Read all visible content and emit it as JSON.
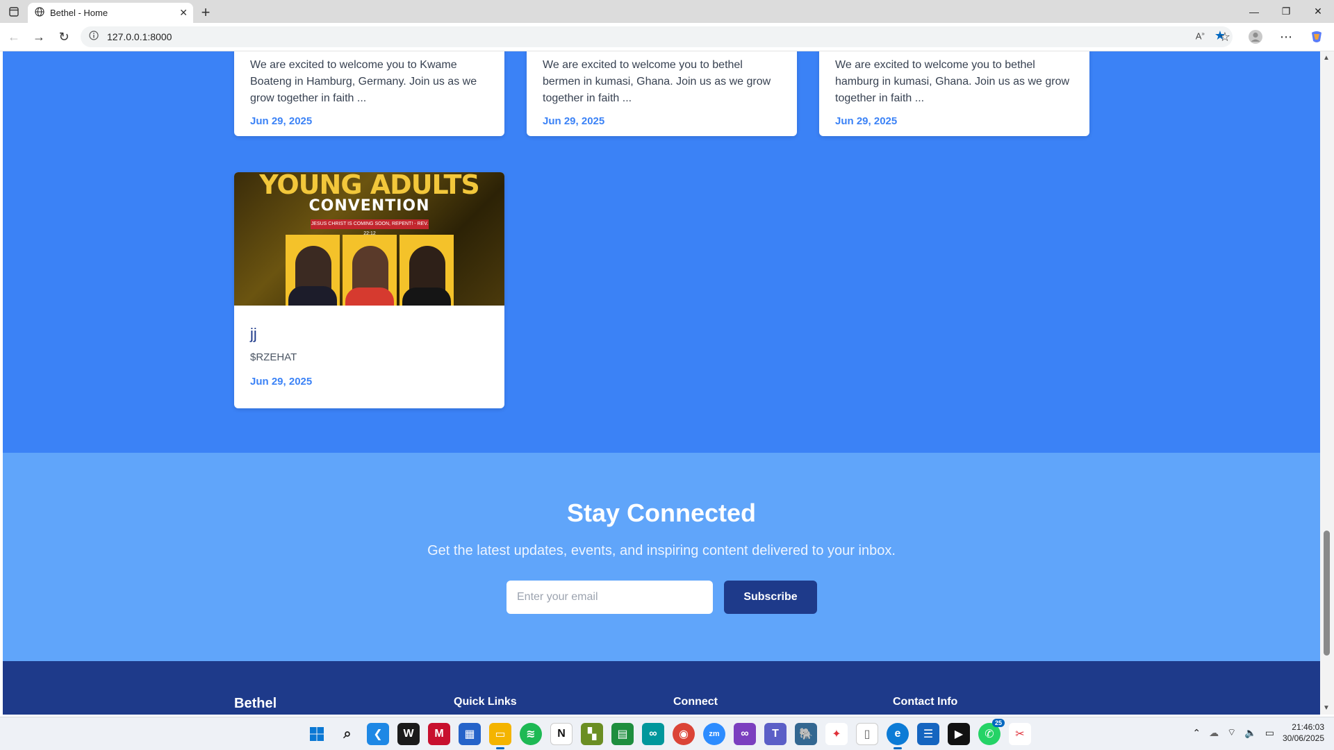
{
  "browser": {
    "tab_title": "Bethel - Home",
    "url": "127.0.0.1:8000"
  },
  "blog": {
    "cards_top": [
      {
        "excerpt": "We are excited to welcome you to Kwame Boateng in Hamburg, Germany. Join us as we grow together in faith ...",
        "date": "Jun 29, 2025"
      },
      {
        "excerpt": "We are excited to welcome you to bethel bermen in kumasi, Ghana. Join us as we grow together in faith ...",
        "date": "Jun 29, 2025"
      },
      {
        "excerpt": "We are excited to welcome you to bethel hamburg in kumasi, Ghana. Join us as we grow together in faith ...",
        "date": "Jun 29, 2025"
      }
    ],
    "featured_card": {
      "image_title": "YOUNG ADULTS",
      "image_subtitle": "CONVENTION",
      "image_banner": "JESUS CHRIST IS COMING SOON, REPENT! - REV. 22:12",
      "title": "jj",
      "author": "$RZEHAT",
      "date": "Jun 29, 2025"
    }
  },
  "newsletter": {
    "title": "Stay Connected",
    "subtitle": "Get the latest updates, events, and inspiring content delivered to your inbox.",
    "email_placeholder": "Enter your email",
    "button_label": "Subscribe"
  },
  "footer": {
    "brand": "Bethel",
    "columns": [
      "Quick Links",
      "Connect",
      "Contact Info"
    ]
  },
  "taskbar": {
    "time": "21:46:03",
    "date": "30/06/2025",
    "whatsapp_badge": "25"
  },
  "colors": {
    "blog_bg": "#3b82f6",
    "newsletter_bg": "#60a5fa",
    "footer_bg": "#1e3a8a",
    "accent": "#3b82f6"
  }
}
